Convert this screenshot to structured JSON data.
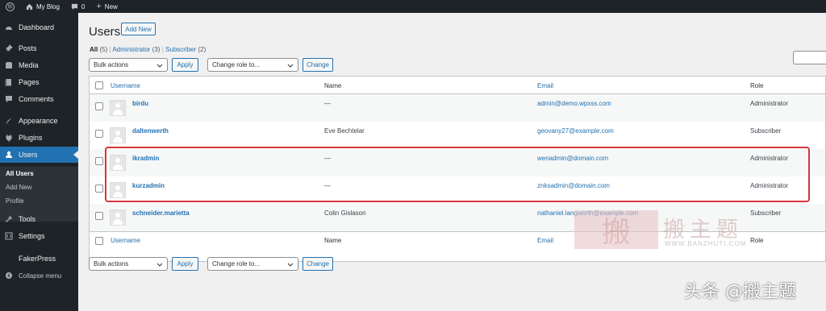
{
  "adminbar": {
    "site_name": "My Blog",
    "comments_count": "0",
    "new_label": "New"
  },
  "sidebar": {
    "items": [
      {
        "label": "Dashboard",
        "icon": "dashboard-icon"
      },
      {
        "label": "Posts",
        "icon": "pin-icon"
      },
      {
        "label": "Media",
        "icon": "media-icon"
      },
      {
        "label": "Pages",
        "icon": "pages-icon"
      },
      {
        "label": "Comments",
        "icon": "comment-icon"
      },
      {
        "label": "Appearance",
        "icon": "brush-icon"
      },
      {
        "label": "Plugins",
        "icon": "plug-icon"
      },
      {
        "label": "Users",
        "icon": "user-icon"
      },
      {
        "label": "Tools",
        "icon": "wrench-icon"
      },
      {
        "label": "Settings",
        "icon": "settings-icon"
      },
      {
        "label": "FakerPress",
        "icon": ""
      },
      {
        "label": "Collapse menu",
        "icon": "collapse-icon"
      }
    ],
    "submenu": [
      "All Users",
      "Add New",
      "Profile"
    ]
  },
  "page": {
    "title": "Users",
    "add_new": "Add New",
    "views": {
      "all": "All",
      "all_count": "(5)",
      "admin": "Administrator",
      "admin_count": "(3)",
      "sub": "Subscriber",
      "sub_count": "(2)"
    },
    "bulk_actions": "Bulk actions",
    "apply": "Apply",
    "change_role": "Change role to...",
    "change": "Change"
  },
  "table": {
    "columns": [
      "Username",
      "Name",
      "Email",
      "Role"
    ],
    "rows": [
      {
        "username": "birdu",
        "name": "—",
        "email": "admin@demo.wpxss.com",
        "role": "Administrator"
      },
      {
        "username": "daltenwerth",
        "name": "Eve Bechtelar",
        "email": "geovany27@example.com",
        "role": "Subscriber"
      },
      {
        "username": "ikradmin",
        "name": "—",
        "email": "wenadmin@domain.com",
        "role": "Administrator"
      },
      {
        "username": "kurzadmin",
        "name": "—",
        "email": "znksadmin@domain.com",
        "role": "Administrator"
      },
      {
        "username": "schneider.marietta",
        "name": "Colin Gislason",
        "email": "nathaniel.langworth@example.com",
        "role": "Subscriber"
      }
    ]
  },
  "watermark": {
    "cn": "搬主题",
    "url": "WWW.BANZHUTI.COM",
    "logo": "搬"
  },
  "credit": "头条 @搬主题",
  "colors": {
    "accent": "#2271b1",
    "adminbar": "#1d2327",
    "highlight": "#d63638"
  }
}
